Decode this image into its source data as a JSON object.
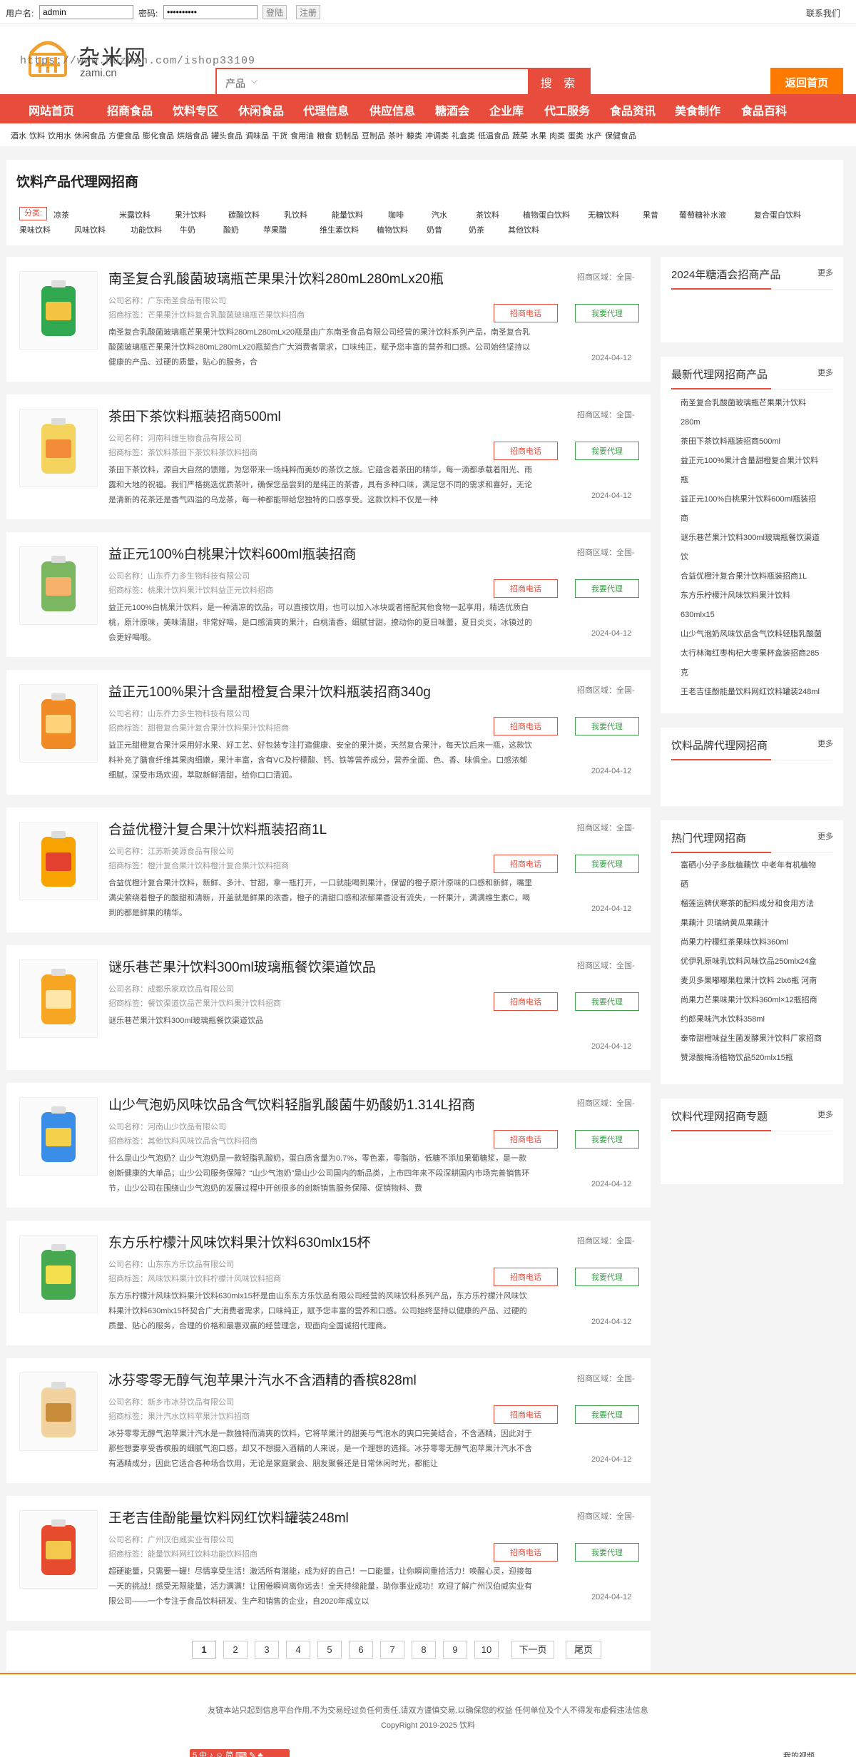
{
  "topbar": {
    "username_label": "用户名:",
    "username_value": "admin",
    "password_label": "密码:",
    "password_value": "••••••••••",
    "login_button": "登陆",
    "register_button": "注册",
    "contact": "联系我们"
  },
  "header": {
    "logo_cn": "杂米网",
    "logo_en": "zami.cn",
    "watermark": "https://www.huzhan.com/ishop33109",
    "search_category": "产品",
    "search_button": "搜 索",
    "home_button": "返回首页"
  },
  "nav": [
    "网站首页",
    "招商食品",
    "饮料专区",
    "休闲食品",
    "代理信息",
    "供应信息",
    "糖酒会",
    "企业库",
    "代工服务",
    "食品资讯",
    "美食制作",
    "食品百科"
  ],
  "tags": [
    "酒水",
    "饮料",
    "饮用水",
    "休闲食品",
    "方便食品",
    "膨化食品",
    "烘焙食品",
    "罐头食品",
    "调味品",
    "干货",
    "食用油",
    "粮食",
    "奶制品",
    "豆制品",
    "茶叶",
    "糠类",
    "冲调类",
    "礼盒类",
    "低温食品",
    "蔬菜",
    "水果",
    "肉类",
    "蛋类",
    "水产",
    "保健食品"
  ],
  "category_box": {
    "title": "饮料产品代理网招商",
    "label": "分类:",
    "row1": [
      "凉茶",
      "米露饮料",
      "果汁饮料",
      "碳酸饮料",
      "乳饮料",
      "能量饮料",
      "咖啡",
      "汽水",
      "茶饮料",
      "植物蛋白饮料",
      "无糖饮料",
      "果昔",
      "葡萄糖补水液",
      "复合蛋白饮料"
    ],
    "row2": [
      "果味饮料",
      "风味饮料",
      "功能饮料",
      "牛奶",
      "酸奶",
      "苹果醋",
      "维生素饮料",
      "植物饮料",
      "奶昔",
      "奶茶",
      "其他饮料"
    ]
  },
  "list": [
    {
      "title": "南圣复合乳酸菌玻璃瓶芒果果汁饮料280mL280mLx20瓶",
      "company": "公司名称：广东南圣食品有限公司",
      "tags": "招商标签：芒果果汁饮料复合乳酸菌玻璃瓶芒果饮料招商",
      "desc": "南圣复合乳酸菌玻璃瓶芒果果汁饮料280mL280mLx20瓶是由广东南圣食品有限公司经营的果汁饮料系列产品，南圣复合乳酸菌玻璃瓶芒果果汁饮料280mL280mLx20瓶契合广大消费者需求，口味纯正，赋予您丰富的营养和口感。公司始终坚持以健康的产品、过硬的质量，贴心的服务，合",
      "region": "招商区域：全国-",
      "btn1": "招商电话",
      "btn2": "我要代理",
      "date": "2024-04-12"
    },
    {
      "title": "茶田下茶饮料瓶装招商500ml",
      "company": "公司名称：河南科维生物食品有限公司",
      "tags": "招商标签：茶饮料茶田下茶饮料茶饮料招商",
      "desc": "茶田下茶饮料，源自大自然的馈赠，为您带来一场纯粹而美妙的茶饮之旅。它蕴含着茶田的精华，每一滴都承载着阳光、雨露和大地的祝福。我们严格挑选优质茶叶，确保您品尝到的是纯正的茶香，具有多种口味，满足您不同的需求和喜好，无论是清新的花茶还是香气四溢的乌龙茶，每一种都能带给您独特的口感享受。这款饮料不仅是一种",
      "region": "招商区域：全国-",
      "btn1": "招商电话",
      "btn2": "我要代理",
      "date": "2024-04-12"
    },
    {
      "title": "益正元100%白桃果汁饮料600ml瓶装招商",
      "company": "公司名称：山东乔力多生物科技有限公司",
      "tags": "招商标签：桃果汁饮料果汁饮料益正元饮料招商",
      "desc": "益正元100%白桃果汁饮料，是一种清凉的饮品，可以直接饮用，也可以加入冰块或者搭配其他食物一起享用，精选优质白桃，原汁原味，美味清甜，非常好喝，是口感清爽的果汁，白桃清香，细腻甘甜，撩动你的夏日味蕾，夏日炎炎，冰镇过的会更好喝哦。",
      "region": "招商区域：全国-",
      "btn1": "招商电话",
      "btn2": "我要代理",
      "date": "2024-04-12"
    },
    {
      "title": "益正元100%果汁含量甜橙复合果汁饮料瓶装招商340g",
      "company": "公司名称：山东乔力多生物科技有限公司",
      "tags": "招商标签：甜橙复合果汁复合果汁饮料果汁饮料招商",
      "desc": "益正元甜橙复合果汁采用好水果、好工艺、好包装专注打造健康、安全的果汁类，天然复合果汁，每天饮后来一瓶，这款饮料补充了膳食纤维其果肉细嫩，果汁丰富，含有VC及柠檬酸、钙、铁等营养成分，营养全面、色、香、味俱全。口感浓郁细腻，深受市场欢迎，萃取新鲜清甜，给你口口清润。",
      "region": "招商区域：全国-",
      "btn1": "招商电话",
      "btn2": "我要代理",
      "date": "2024-04-12"
    },
    {
      "title": "合益优橙汁复合果汁饮料瓶装招商1L",
      "company": "公司名称：江苏新美源食品有限公司",
      "tags": "招商标签：橙汁复合果汁饮料橙汁复合果汁饮料招商",
      "desc": "合益优橙汁复合果汁饮料，新鲜、多汁、甘甜，拿一瓶打开，一口就能喝到果汁，保留的橙子原汁原味的口感和新鲜，嘴里满尖萦绕着橙子的酸甜和清新，开盖就是鲜果的浓香，橙子的清甜口感和浓郁果香没有流失，一杯果汁，满满维生素C，喝到的都是鲜果的精华。",
      "region": "招商区域：全国-",
      "btn1": "招商电话",
      "btn2": "我要代理",
      "date": "2024-04-12"
    },
    {
      "title": "谜乐巷芒果汁饮料300ml玻璃瓶餐饮渠道饮品",
      "company": "公司名称：成都乐家欢饮品有限公司",
      "tags": "招商标签：餐饮渠道饮品芒果汁饮料果汁饮料招商",
      "desc": "谜乐巷芒果汁饮料300ml玻璃瓶餐饮渠道饮品",
      "region": "招商区域：全国-",
      "btn1": "招商电话",
      "btn2": "我要代理",
      "date": "2024-04-12"
    },
    {
      "title": "山少气泡奶风味饮品含气饮料轻脂乳酸菌牛奶酸奶1.314L招商",
      "company": "公司名称：河南山少饮品有限公司",
      "tags": "招商标签：其他饮料风味饮品含气饮料招商",
      "desc": "什么是山少气泡奶？山少气泡奶是一款轻脂乳酸奶，蛋白质含量为0.7%，零色素，零脂肪，低糖不添加果葡糖浆，是一款创新健康的大单品；山少公司服务保障？“山少气泡奶”是山少公司国内的新品类，上市四年来不段深耕国内市场完善销售环节，山少公司在围绕山少气泡奶的发展过程中开创很多的创新销售服务保障、促销物料、费",
      "region": "招商区域：全国-",
      "btn1": "招商电话",
      "btn2": "我要代理",
      "date": "2024-04-12"
    },
    {
      "title": "东方乐柠檬汁风味饮料果汁饮料630mlx15杯",
      "company": "公司名称：山东东方乐饮品有限公司",
      "tags": "招商标签：风味饮料果汁饮料柠檬汁风味饮料招商",
      "desc": "东方乐柠檬汁风味饮料果汁饮料630mlx15杯是由山东东方乐饮品有限公司经营的风味饮料系列产品，东方乐柠檬汁风味饮料果汁饮料630mlx15杯契合广大消费者需求，口味纯正，赋予您丰富的营养和口感。公司始终坚持以健康的产品、过硬的质量、贴心的服务，合理的价格和最惠双赢的经营理念，现面向全国诚招代理商。",
      "region": "招商区域：全国-",
      "btn1": "招商电话",
      "btn2": "我要代理",
      "date": "2024-04-12"
    },
    {
      "title": "冰芬零零无醇气泡苹果汁汽水不含酒精的香槟828ml",
      "company": "公司名称：新乡市冰芬饮品有限公司",
      "tags": "招商标签：果汁汽水饮料苹果汁饮料招商",
      "desc": "冰芬零零无醇气泡苹果汁汽水是一款独特而清爽的饮料，它将苹果汁的甜美与气泡水的爽口完美结合，不含酒精，因此对于那些想要享受香槟般的细腻气泡口感，却又不想摄入酒精的人来说，是一个理想的选择。冰芬零零无醇气泡苹果汁汽水不含有酒精成分，因此它适合各种场合饮用，无论是家庭聚会、朋友聚餐还是日常休闲时光，都能让",
      "region": "招商区域：全国-",
      "btn1": "招商电话",
      "btn2": "我要代理",
      "date": "2024-04-12"
    },
    {
      "title": "王老吉佳酚能量饮料网红饮料罐装248ml",
      "company": "公司名称：广州汉伯威实业有限公司",
      "tags": "招商标签：能量饮料网红饮料功能饮料招商",
      "desc": "超硬能量，只需要一罐！尽情享受生活！激活所有潜能，成为好的自己！一口能量，让你瞬间重拾活力！唤醒心灵，迎接每一天的挑战！感受无限能量，活力满满！让困倦瞬间离你远去！全天持续能量，助你事业成功！欢迎了解广州汉伯威实业有限公司——一个专注于食品饮料研发、生产和销售的企业，自2020年成立以",
      "region": "招商区域：全国-",
      "btn1": "招商电话",
      "btn2": "我要代理",
      "date": "2024-04-12"
    }
  ],
  "pager": [
    "1",
    "2",
    "3",
    "4",
    "5",
    "6",
    "7",
    "8",
    "9",
    "10",
    "下一页",
    "尾页"
  ],
  "sidebar": [
    {
      "title": "2024年糖酒会招商产品",
      "more": "更多",
      "items": []
    },
    {
      "title": "最新代理网招商产品",
      "more": "更多",
      "items": [
        "南圣复合乳酸菌玻璃瓶芒果果汁饮料",
        "280m",
        "茶田下茶饮料瓶装招商500ml",
        "益正元100%果汁含量甜橙复合果汁饮料",
        "瓶",
        "益正元100%白桃果汁饮料600ml瓶装招",
        "商",
        "谜乐巷芒果汁饮料300ml玻璃瓶餐饮渠道",
        "饮",
        "合益优橙汁复合果汁饮料瓶装招商1L",
        "东方乐柠檬汁风味饮料果汁饮料",
        "630mlx15",
        "山少气泡奶风味饮品含气饮料轻脂乳酸菌",
        "太行林海红枣枸杞大枣果杯盒装招商285",
        "克",
        "王老吉佳酚能量饮料网红饮料罐装248ml"
      ]
    },
    {
      "title": "饮料品牌代理网招商",
      "more": "更多",
      "items": []
    },
    {
      "title": "热门代理网招商",
      "more": "更多",
      "items": [
        "富硒小分子多肽植藕饮 中老年有机植物",
        "硒",
        "榴莲运牌伏寒茶的配料成分和食用方法",
        "果藕汁 贝瑞纳黄瓜果藕汁",
        "尚果力柠檬红茶果味饮料360ml",
        "优伊乳原味乳饮料风味饮品250mlx24盒",
        "麦贝多果嘟嘟果粒果汁饮料 2lx6瓶 河南",
        "尚果力芒果味果汁饮料360ml×12瓶招商",
        "约郎果味汽水饮料358ml",
        "泰帝甜橙味益生菌发酵果汁饮料厂家招商",
        "赞渌酸梅汤植物饮品520mlx15瓶"
      ]
    },
    {
      "title": "饮料代理网招商专题",
      "more": "更多",
      "items": []
    }
  ],
  "footer": {
    "line1": "友链本站只起到信息平台作用,不为交易经过负任何责任,请双方谨慎交易,以确保您的权益 任何单位及个人不得发布虚假违法信息",
    "line2": "CopyRight 2019-2025 饮料",
    "badge": "5 中 ♪ ☺ 简 ⌨ ✎ ♣",
    "my_video": "我的视频"
  },
  "colors": {
    "accent": "#e84c3d",
    "orange": "#ff7a00",
    "green": "#3fa34d"
  }
}
